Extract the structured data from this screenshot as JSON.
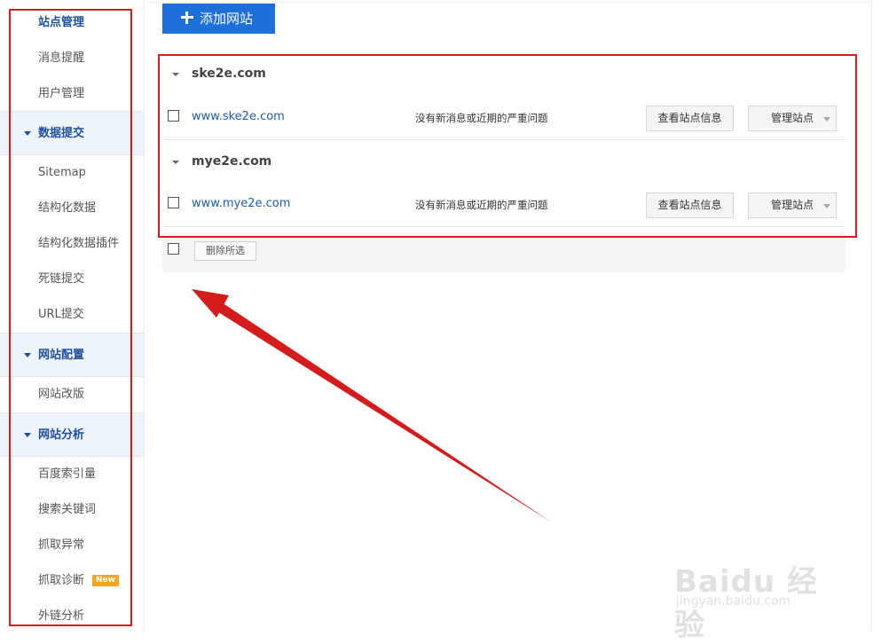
{
  "sidebar": {
    "items": [
      {
        "label": "站点管理",
        "active": true
      },
      {
        "label": "消息提醒"
      },
      {
        "label": "用户管理"
      }
    ],
    "groups": [
      {
        "title": "数据提交",
        "items": [
          {
            "label": "Sitemap"
          },
          {
            "label": "结构化数据"
          },
          {
            "label": "结构化数据插件"
          },
          {
            "label": "死链提交"
          },
          {
            "label": "URL提交"
          }
        ]
      },
      {
        "title": "网站配置",
        "items": [
          {
            "label": "网站改版"
          }
        ]
      },
      {
        "title": "网站分析",
        "items": [
          {
            "label": "百度索引量"
          },
          {
            "label": "搜索关键词"
          },
          {
            "label": "抓取异常"
          },
          {
            "label": "抓取诊断",
            "badge": "New"
          },
          {
            "label": "外链分析"
          }
        ]
      }
    ]
  },
  "toolbar": {
    "add_site_label": "添加网站"
  },
  "domains": [
    {
      "name": "ske2e.com",
      "site": {
        "url": "www.ske2e.com",
        "status": "没有新消息或近期的严重问题",
        "view_label": "查看站点信息",
        "manage_label": "管理站点"
      }
    },
    {
      "name": "mye2e.com",
      "site": {
        "url": "www.mye2e.com",
        "status": "没有新消息或近期的严重问题",
        "view_label": "查看站点信息",
        "manage_label": "管理站点"
      }
    }
  ],
  "bulk": {
    "delete_label": "删除所选"
  },
  "watermark": {
    "brand": "Baidu 经验",
    "url": "jingyan.baidu.com"
  },
  "colors": {
    "accent": "#1e6fd9",
    "link": "#1f5fa8",
    "annotation": "#d41c1c",
    "badge": "#f5a623"
  }
}
